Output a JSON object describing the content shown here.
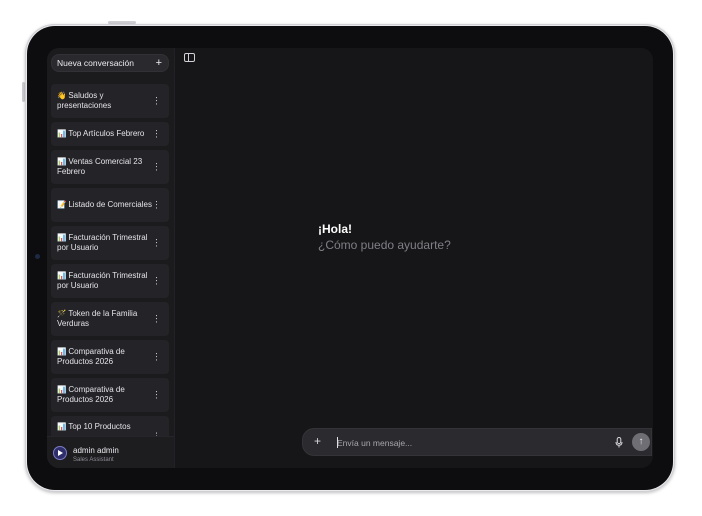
{
  "sidebar": {
    "new_chat_label": "Nueva conversación",
    "conversations": [
      {
        "emoji": "👋",
        "title": "Saludos y presentaciones"
      },
      {
        "emoji": "📊",
        "title": "Top Artículos Febrero"
      },
      {
        "emoji": "📊",
        "title": "Ventas Comercial 23 Febrero"
      },
      {
        "emoji": "📝",
        "title": "Listado de Comerciales"
      },
      {
        "emoji": "📊",
        "title": "Facturación Trimestral por Usuario"
      },
      {
        "emoji": "📊",
        "title": "Facturación Trimestral por Usuario"
      },
      {
        "emoji": "🪄",
        "title": "Token de la Familia Verduras"
      },
      {
        "emoji": "📊",
        "title": "Comparativa de Productos 2026"
      },
      {
        "emoji": "📊",
        "title": "Comparativa de Productos 2026"
      },
      {
        "emoji": "📊",
        "title": "Top 10 Productos"
      }
    ],
    "more_icon": "vertical-ellipsis-icon"
  },
  "user": {
    "name": "admin admin",
    "role": "Sales Assistant"
  },
  "main": {
    "greeting": "¡Hola!",
    "subgreeting": "¿Cómo puedo ayudarte?"
  },
  "composer": {
    "placeholder": "Envía un mensaje...",
    "value": ""
  },
  "colors": {
    "background": "#161618",
    "sidebar": "#1b1b1e",
    "item": "#242428",
    "composer": "#2b2b2f",
    "send_button": "#6e6e74"
  }
}
